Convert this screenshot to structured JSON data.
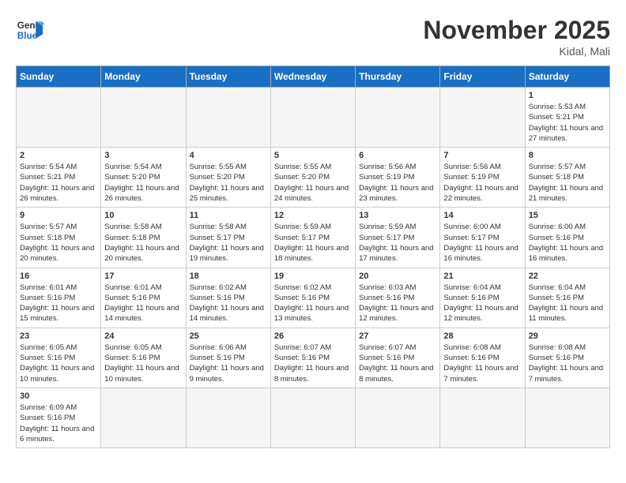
{
  "header": {
    "logo_line1": "General",
    "logo_line2": "Blue",
    "month": "November 2025",
    "location": "Kidal, Mali"
  },
  "days_of_week": [
    "Sunday",
    "Monday",
    "Tuesday",
    "Wednesday",
    "Thursday",
    "Friday",
    "Saturday"
  ],
  "weeks": [
    {
      "days": [
        {
          "num": "",
          "empty": true
        },
        {
          "num": "",
          "empty": true
        },
        {
          "num": "",
          "empty": true
        },
        {
          "num": "",
          "empty": true
        },
        {
          "num": "",
          "empty": true
        },
        {
          "num": "",
          "empty": true
        },
        {
          "num": "1",
          "sunrise": "5:53 AM",
          "sunset": "5:21 PM",
          "daylight": "11 hours and 27 minutes."
        }
      ]
    },
    {
      "days": [
        {
          "num": "2",
          "sunrise": "5:54 AM",
          "sunset": "5:21 PM",
          "daylight": "11 hours and 26 minutes."
        },
        {
          "num": "3",
          "sunrise": "5:54 AM",
          "sunset": "5:20 PM",
          "daylight": "11 hours and 26 minutes."
        },
        {
          "num": "4",
          "sunrise": "5:55 AM",
          "sunset": "5:20 PM",
          "daylight": "11 hours and 25 minutes."
        },
        {
          "num": "5",
          "sunrise": "5:55 AM",
          "sunset": "5:20 PM",
          "daylight": "11 hours and 24 minutes."
        },
        {
          "num": "6",
          "sunrise": "5:56 AM",
          "sunset": "5:19 PM",
          "daylight": "11 hours and 23 minutes."
        },
        {
          "num": "7",
          "sunrise": "5:56 AM",
          "sunset": "5:19 PM",
          "daylight": "11 hours and 22 minutes."
        },
        {
          "num": "8",
          "sunrise": "5:57 AM",
          "sunset": "5:18 PM",
          "daylight": "11 hours and 21 minutes."
        }
      ]
    },
    {
      "days": [
        {
          "num": "9",
          "sunrise": "5:57 AM",
          "sunset": "5:18 PM",
          "daylight": "11 hours and 20 minutes."
        },
        {
          "num": "10",
          "sunrise": "5:58 AM",
          "sunset": "5:18 PM",
          "daylight": "11 hours and 20 minutes."
        },
        {
          "num": "11",
          "sunrise": "5:58 AM",
          "sunset": "5:17 PM",
          "daylight": "11 hours and 19 minutes."
        },
        {
          "num": "12",
          "sunrise": "5:59 AM",
          "sunset": "5:17 PM",
          "daylight": "11 hours and 18 minutes."
        },
        {
          "num": "13",
          "sunrise": "5:59 AM",
          "sunset": "5:17 PM",
          "daylight": "11 hours and 17 minutes."
        },
        {
          "num": "14",
          "sunrise": "6:00 AM",
          "sunset": "5:17 PM",
          "daylight": "11 hours and 16 minutes."
        },
        {
          "num": "15",
          "sunrise": "6:00 AM",
          "sunset": "5:16 PM",
          "daylight": "11 hours and 16 minutes."
        }
      ]
    },
    {
      "days": [
        {
          "num": "16",
          "sunrise": "6:01 AM",
          "sunset": "5:16 PM",
          "daylight": "11 hours and 15 minutes."
        },
        {
          "num": "17",
          "sunrise": "6:01 AM",
          "sunset": "5:16 PM",
          "daylight": "11 hours and 14 minutes."
        },
        {
          "num": "18",
          "sunrise": "6:02 AM",
          "sunset": "5:16 PM",
          "daylight": "11 hours and 14 minutes."
        },
        {
          "num": "19",
          "sunrise": "6:02 AM",
          "sunset": "5:16 PM",
          "daylight": "11 hours and 13 minutes."
        },
        {
          "num": "20",
          "sunrise": "6:03 AM",
          "sunset": "5:16 PM",
          "daylight": "11 hours and 12 minutes."
        },
        {
          "num": "21",
          "sunrise": "6:04 AM",
          "sunset": "5:16 PM",
          "daylight": "11 hours and 12 minutes."
        },
        {
          "num": "22",
          "sunrise": "6:04 AM",
          "sunset": "5:16 PM",
          "daylight": "11 hours and 11 minutes."
        }
      ]
    },
    {
      "days": [
        {
          "num": "23",
          "sunrise": "6:05 AM",
          "sunset": "5:16 PM",
          "daylight": "11 hours and 10 minutes."
        },
        {
          "num": "24",
          "sunrise": "6:05 AM",
          "sunset": "5:16 PM",
          "daylight": "11 hours and 10 minutes."
        },
        {
          "num": "25",
          "sunrise": "6:06 AM",
          "sunset": "5:16 PM",
          "daylight": "11 hours and 9 minutes."
        },
        {
          "num": "26",
          "sunrise": "6:07 AM",
          "sunset": "5:16 PM",
          "daylight": "11 hours and 8 minutes."
        },
        {
          "num": "27",
          "sunrise": "6:07 AM",
          "sunset": "5:16 PM",
          "daylight": "11 hours and 8 minutes."
        },
        {
          "num": "28",
          "sunrise": "6:08 AM",
          "sunset": "5:16 PM",
          "daylight": "11 hours and 7 minutes."
        },
        {
          "num": "29",
          "sunrise": "6:08 AM",
          "sunset": "5:16 PM",
          "daylight": "11 hours and 7 minutes."
        }
      ]
    },
    {
      "days": [
        {
          "num": "30",
          "sunrise": "6:09 AM",
          "sunset": "5:16 PM",
          "daylight": "11 hours and 6 minutes."
        },
        {
          "num": "",
          "empty": true
        },
        {
          "num": "",
          "empty": true
        },
        {
          "num": "",
          "empty": true
        },
        {
          "num": "",
          "empty": true
        },
        {
          "num": "",
          "empty": true
        },
        {
          "num": "",
          "empty": true
        }
      ]
    }
  ]
}
